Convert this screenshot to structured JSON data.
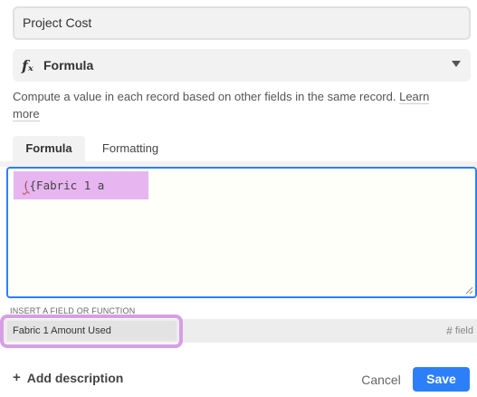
{
  "field_name": {
    "value": "Project Cost"
  },
  "field_type": {
    "icon": "formula-icon",
    "icon_glyph": "fₓ",
    "label": "Formula"
  },
  "description": {
    "text": "Compute a value in each record based on other fields in the same record.",
    "learn_more": "Learn more"
  },
  "tabs": [
    {
      "label": "Formula",
      "active": true
    },
    {
      "label": "Formatting",
      "active": false
    }
  ],
  "editor": {
    "paren": "(",
    "text": "{Fabric 1 a"
  },
  "autocomplete": {
    "header": "INSERT A FIELD OR FUNCTION",
    "item_label": "Fabric 1 Amount Used",
    "item_type_icon": "hash-icon",
    "item_type": "field"
  },
  "footer": {
    "add_description": "Add description",
    "cancel": "Cancel",
    "save": "Save"
  },
  "colors": {
    "accent": "#2d7ff9",
    "highlight": "#e7b5f0",
    "highlight_ring": "#d79fe3"
  }
}
